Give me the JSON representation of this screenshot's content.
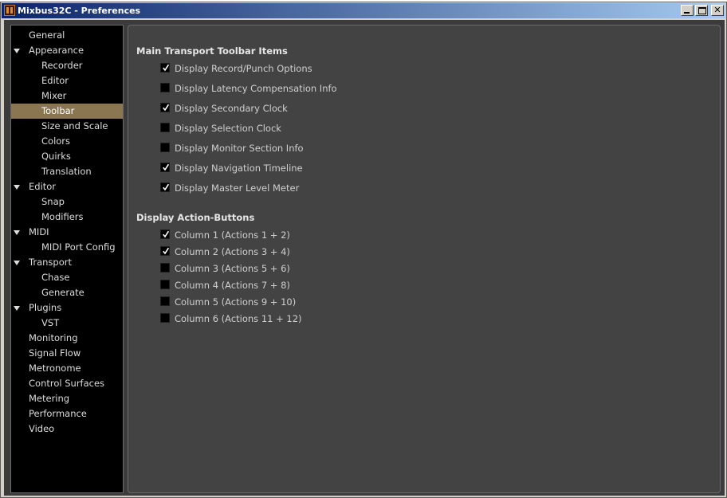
{
  "window": {
    "title": "Mixbus32C - Preferences"
  },
  "sidebar": {
    "selected": "Toolbar",
    "items": [
      {
        "label": "General",
        "level": 0,
        "expander": false
      },
      {
        "label": "Appearance",
        "level": 0,
        "expander": true
      },
      {
        "label": "Recorder",
        "level": 1,
        "expander": false
      },
      {
        "label": "Editor",
        "level": 1,
        "expander": false
      },
      {
        "label": "Mixer",
        "level": 1,
        "expander": false
      },
      {
        "label": "Toolbar",
        "level": 1,
        "expander": false
      },
      {
        "label": "Size and Scale",
        "level": 1,
        "expander": false
      },
      {
        "label": "Colors",
        "level": 1,
        "expander": false
      },
      {
        "label": "Quirks",
        "level": 1,
        "expander": false
      },
      {
        "label": "Translation",
        "level": 1,
        "expander": false
      },
      {
        "label": "Editor",
        "level": 0,
        "expander": true
      },
      {
        "label": "Snap",
        "level": 1,
        "expander": false
      },
      {
        "label": "Modifiers",
        "level": 1,
        "expander": false
      },
      {
        "label": "MIDI",
        "level": 0,
        "expander": true
      },
      {
        "label": "MIDI Port Config",
        "level": 1,
        "expander": false
      },
      {
        "label": "Transport",
        "level": 0,
        "expander": true
      },
      {
        "label": "Chase",
        "level": 1,
        "expander": false
      },
      {
        "label": "Generate",
        "level": 1,
        "expander": false
      },
      {
        "label": "Plugins",
        "level": 0,
        "expander": true
      },
      {
        "label": "VST",
        "level": 1,
        "expander": false
      },
      {
        "label": "Monitoring",
        "level": 0,
        "expander": false
      },
      {
        "label": "Signal Flow",
        "level": 0,
        "expander": false
      },
      {
        "label": "Metronome",
        "level": 0,
        "expander": false
      },
      {
        "label": "Control Surfaces",
        "level": 0,
        "expander": false
      },
      {
        "label": "Metering",
        "level": 0,
        "expander": false
      },
      {
        "label": "Performance",
        "level": 0,
        "expander": false
      },
      {
        "label": "Video",
        "level": 0,
        "expander": false
      }
    ]
  },
  "transport_section": {
    "title": "Main Transport Toolbar Items",
    "options": [
      {
        "label": "Display Record/Punch Options",
        "checked": true
      },
      {
        "label": "Display Latency Compensation Info",
        "checked": false
      },
      {
        "label": "Display Secondary Clock",
        "checked": true
      },
      {
        "label": "Display Selection Clock",
        "checked": false
      },
      {
        "label": "Display Monitor Section Info",
        "checked": false
      },
      {
        "label": "Display Navigation Timeline",
        "checked": true
      },
      {
        "label": "Display Master Level Meter",
        "checked": true
      }
    ]
  },
  "action_section": {
    "title": "Display Action-Buttons",
    "options": [
      {
        "label": "Column 1 (Actions 1 + 2)",
        "checked": true
      },
      {
        "label": "Column 2 (Actions 3 + 4)",
        "checked": true
      },
      {
        "label": "Column 3 (Actions 5 + 6)",
        "checked": false
      },
      {
        "label": "Column 4 (Actions 7 + 8)",
        "checked": false
      },
      {
        "label": "Column 5 (Actions 9 + 10)",
        "checked": false
      },
      {
        "label": "Column 6 (Actions 11 + 12)",
        "checked": false
      }
    ]
  },
  "colors": {
    "selection": "#8a7650",
    "sidebar_bg": "#000000",
    "content_bg": "#444344"
  }
}
